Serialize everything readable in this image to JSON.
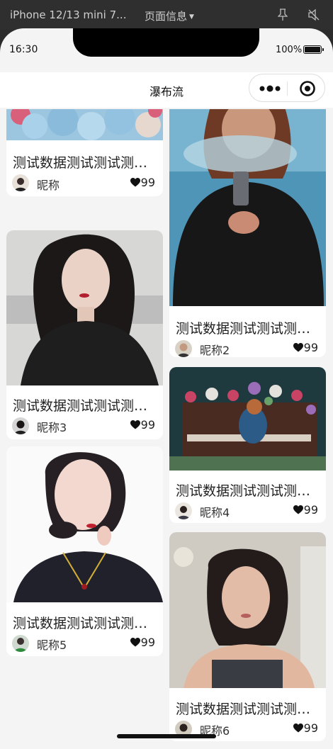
{
  "devtools": {
    "device": "iPhone 12/13 mini 7...",
    "page_info": "页面信息"
  },
  "status": {
    "time": "16:30",
    "battery": "100%"
  },
  "navbar": {
    "title": "瀑布流"
  },
  "cards": [
    {
      "title": "测试数据测试测试测试测试测试",
      "nickname": "昵称",
      "likes": "99",
      "image": "blue-flowers-photo",
      "avatar": "avatar-photo"
    },
    {
      "title": "测试数据测试测试测试测试测试",
      "nickname": "昵称2",
      "likes": "99",
      "image": "woman-smoke-photo",
      "avatar": "avatar-photo"
    },
    {
      "title": "测试数据测试测试测试测试测试",
      "nickname": "昵称3",
      "likes": "99",
      "image": "woman-seaside-photo",
      "avatar": "avatar-photo"
    },
    {
      "title": "测试数据测试测试测试测试测试",
      "nickname": "昵称4",
      "likes": "99",
      "image": "piano-flowers-photo",
      "avatar": "avatar-photo"
    },
    {
      "title": "测试数据测试测试测试测试测试",
      "nickname": "昵称5",
      "likes": "99",
      "image": "illustrated-woman-photo",
      "avatar": "avatar-photo"
    },
    {
      "title": "测试数据测试测试测试测试测试",
      "nickname": "昵称6",
      "likes": "99",
      "image": "woman-portrait-photo",
      "avatar": "avatar-photo"
    }
  ]
}
